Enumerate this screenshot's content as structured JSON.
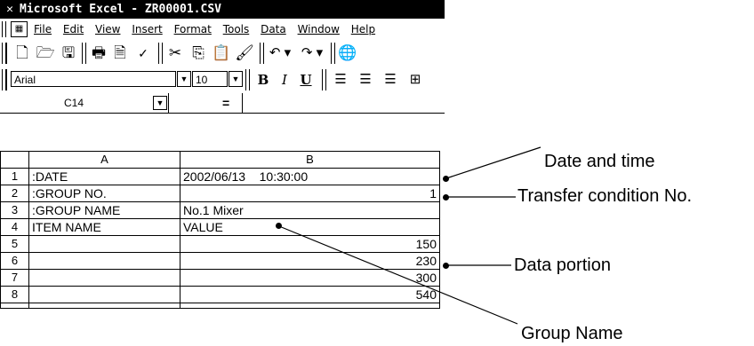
{
  "window": {
    "title": "Microsoft Excel - ZR00001.CSV"
  },
  "menubar": {
    "items": [
      "File",
      "Edit",
      "View",
      "Insert",
      "Format",
      "Tools",
      "Data",
      "Window",
      "Help"
    ]
  },
  "toolbar_standard": {
    "icons": [
      "new-icon",
      "open-icon",
      "save-icon",
      "print-icon",
      "print-preview-icon",
      "spelling-icon",
      "cut-icon",
      "copy-icon",
      "paste-icon",
      "format-painter-icon",
      "undo-icon",
      "redo-icon",
      "web-icon"
    ]
  },
  "toolbar_format": {
    "font": "Arial",
    "size": "10",
    "bold": "B",
    "italic": "I",
    "underline": "U"
  },
  "formula_bar": {
    "cell_ref": "C14",
    "equals": "="
  },
  "sheet": {
    "columns": [
      "A",
      "B"
    ],
    "rows": [
      {
        "num": "1",
        "a": ":DATE",
        "b": "2002/06/13    10:30:00",
        "b_align": "left"
      },
      {
        "num": "2",
        "a": ":GROUP NO.",
        "b": "1",
        "b_align": "right"
      },
      {
        "num": "3",
        "a": ":GROUP NAME",
        "b": "No.1 Mixer",
        "b_align": "left"
      },
      {
        "num": "4",
        "a": "ITEM NAME",
        "b": "VALUE",
        "b_align": "left"
      },
      {
        "num": "5",
        "a": "",
        "b": "150",
        "b_align": "right"
      },
      {
        "num": "6",
        "a": "",
        "b": "230",
        "b_align": "right"
      },
      {
        "num": "7",
        "a": "",
        "b": "300",
        "b_align": "right"
      },
      {
        "num": "8",
        "a": "",
        "b": "540",
        "b_align": "right"
      }
    ]
  },
  "callouts": {
    "date_time": "Date and time",
    "transfer": "Transfer condition No.",
    "data_portion": "Data portion",
    "group_name": "Group Name"
  }
}
